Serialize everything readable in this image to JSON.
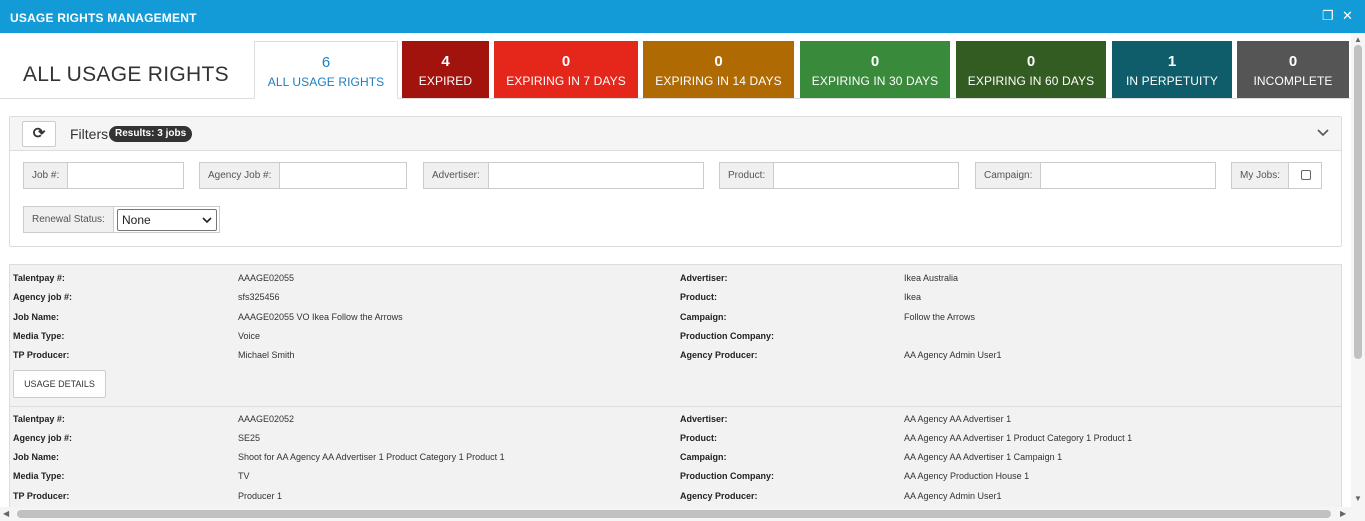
{
  "window": {
    "title": "USAGE RIGHTS MANAGEMENT",
    "restore_icon": "restore-window-icon",
    "close_icon": "close-icon",
    "restore_glyph": "❐",
    "close_glyph": "✕",
    "accent_color": "#139bd7"
  },
  "page": {
    "title": "ALL USAGE RIGHTS"
  },
  "stat_tabs": [
    {
      "count": "6",
      "label": "ALL USAGE RIGHTS",
      "color": "#ffffff",
      "active": true
    },
    {
      "count": "4",
      "label": "EXPIRED",
      "color": "#a3130d"
    },
    {
      "count": "0",
      "label": "EXPIRING IN 7 DAYS",
      "color": "#e5261b"
    },
    {
      "count": "0",
      "label": "EXPIRING IN 14 DAYS",
      "color": "#b06a04"
    },
    {
      "count": "0",
      "label": "EXPIRING IN 30 DAYS",
      "color": "#3a8a3c"
    },
    {
      "count": "0",
      "label": "EXPIRING IN 60 DAYS",
      "color": "#325c22"
    },
    {
      "count": "1",
      "label": "IN PERPETUITY",
      "color": "#0f5d6a"
    },
    {
      "count": "0",
      "label": "INCOMPLETE",
      "color": "#555555"
    }
  ],
  "filters": {
    "label": "Filters",
    "results_badge": "Results: 3 jobs",
    "refresh_icon": "refresh-icon",
    "refresh_glyph": "⟳",
    "collapse_icon": "chevron-down-icon",
    "job_label": "Job #:",
    "job_value": "",
    "agency_job_label": "Agency Job #:",
    "agency_job_value": "",
    "advertiser_label": "Advertiser:",
    "advertiser_value": "",
    "product_label": "Product:",
    "product_value": "",
    "campaign_label": "Campaign:",
    "campaign_value": "",
    "my_jobs_label": "My Jobs:",
    "my_jobs_checked": false,
    "renewal_status_label": "Renewal Status:",
    "renewal_status_value": "None"
  },
  "job_labels": {
    "talentpay": "Talentpay #:",
    "agency_job": "Agency job #:",
    "job_name": "Job Name:",
    "media_type": "Media Type:",
    "tp_producer": "TP Producer:",
    "advertiser": "Advertiser:",
    "product": "Product:",
    "campaign": "Campaign:",
    "production_company": "Production Company:",
    "agency_producer": "Agency Producer:",
    "usage_details_button": "USAGE DETAILS"
  },
  "jobs": [
    {
      "talentpay": "AAAGE02055",
      "agency_job": "sfs325456",
      "job_name": "AAAGE02055 VO Ikea Follow the Arrows",
      "media_type": "Voice",
      "tp_producer": "Michael Smith",
      "advertiser": "Ikea Australia",
      "product": "Ikea",
      "campaign": "Follow the Arrows",
      "production_company": "",
      "agency_producer": "AA Agency Admin User1"
    },
    {
      "talentpay": "AAAGE02052",
      "agency_job": "SE25",
      "job_name": "Shoot for AA Agency AA Advertiser 1 Product Category 1 Product 1",
      "media_type": "TV",
      "tp_producer": "Producer 1",
      "advertiser": "AA Agency AA Advertiser 1",
      "product": "AA Agency AA Advertiser 1 Product Category 1 Product 1",
      "campaign": "AA Agency AA Advertiser 1 Campaign 1",
      "production_company": "AA Agency Production House 1",
      "agency_producer": "AA Agency Admin User1"
    }
  ],
  "scrollbars": {
    "up_glyph": "▲",
    "down_glyph": "▼",
    "left_glyph": "◀",
    "right_glyph": "▶"
  }
}
